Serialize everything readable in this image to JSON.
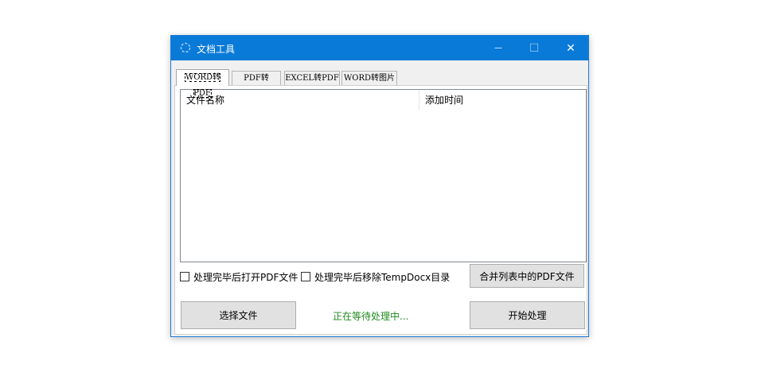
{
  "window": {
    "title": "文档工具",
    "minimize": "—",
    "maximize": "☐",
    "close": "✕"
  },
  "tabs": [
    {
      "label": "WORD转PDF"
    },
    {
      "label": "PDF转WORD"
    },
    {
      "label": "EXCEL转PDF"
    },
    {
      "label": "WORD转图片"
    }
  ],
  "list": {
    "columns": [
      "文件名称",
      "添加时间"
    ]
  },
  "options": {
    "open_pdf_after": "处理完毕后打开PDF文件",
    "remove_temp_after": "处理完毕后移除TempDocx目录"
  },
  "buttons": {
    "merge": "合并列表中的PDF文件",
    "select_files": "选择文件",
    "start": "开始处理"
  },
  "status": {
    "text": "正在等待处理中..."
  }
}
